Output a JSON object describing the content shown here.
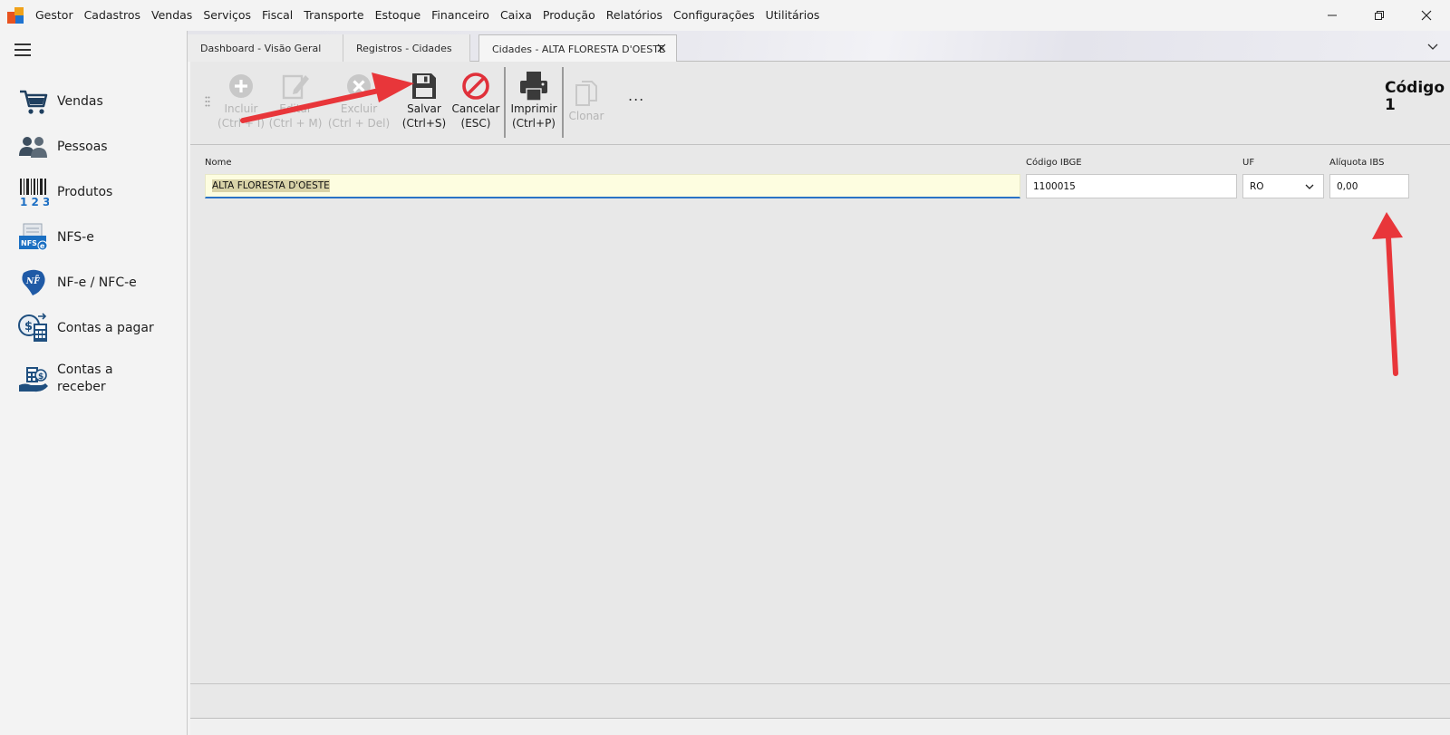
{
  "menu": {
    "items": [
      "Gestor",
      "Cadastros",
      "Vendas",
      "Serviços",
      "Fiscal",
      "Transporte",
      "Estoque",
      "Financeiro",
      "Caixa",
      "Produção",
      "Relatórios",
      "Configurações",
      "Utilitários"
    ]
  },
  "sidebar": {
    "items": [
      {
        "label": "Vendas",
        "icon": "cart-icon"
      },
      {
        "label": "Pessoas",
        "icon": "people-icon"
      },
      {
        "label": "Produtos",
        "icon": "barcode-icon"
      },
      {
        "label": "NFS-e",
        "icon": "nfse-icon"
      },
      {
        "label": "NF-e / NFC-e",
        "icon": "nfe-icon"
      },
      {
        "label": "Contas a pagar",
        "icon": "calculator-money-icon"
      },
      {
        "label": "Contas a receber",
        "icon": "hand-money-icon"
      }
    ]
  },
  "tabs": [
    {
      "label": "Dashboard - Visão Geral",
      "active": false
    },
    {
      "label": "Registros - Cidades",
      "active": false
    },
    {
      "label": "Cidades - ALTA FLORESTA D'OESTE",
      "active": true
    }
  ],
  "toolbar": {
    "buttons": [
      {
        "line1": "Incluir",
        "line2": "(Ctrl + I)",
        "enabled": false,
        "icon": "plus-circle-icon"
      },
      {
        "line1": "Editar",
        "line2": "(Ctrl + M)",
        "enabled": false,
        "icon": "edit-icon"
      },
      {
        "line1": "Excluir",
        "line2": "(Ctrl + Del)",
        "enabled": false,
        "icon": "delete-circle-icon"
      },
      {
        "line1": "Salvar",
        "line2": "(Ctrl+S)",
        "enabled": true,
        "icon": "save-icon"
      },
      {
        "line1": "Cancelar",
        "line2": "(ESC)",
        "enabled": true,
        "icon": "cancel-icon"
      },
      {
        "line1": "Imprimir",
        "line2": "(Ctrl+P)",
        "enabled": true,
        "icon": "printer-icon"
      },
      {
        "line1": "Clonar",
        "line2": "",
        "enabled": false,
        "icon": "copy-icon"
      }
    ],
    "more": "...",
    "codigo_label": "Código",
    "codigo_value": "1"
  },
  "form": {
    "nome_label": "Nome",
    "nome_value": "ALTA FLORESTA D'OESTE",
    "ibge_label": "Código IBGE",
    "ibge_value": "1100015",
    "uf_label": "UF",
    "uf_value": "RO",
    "aliquota_label": "Alíquota IBS",
    "aliquota_value": "0,00"
  },
  "colors": {
    "annotation_arrow": "#e8363a",
    "cancel_red": "#e0303a",
    "focus_blue": "#2a73c6",
    "field_highlight": "#fdfde0"
  }
}
